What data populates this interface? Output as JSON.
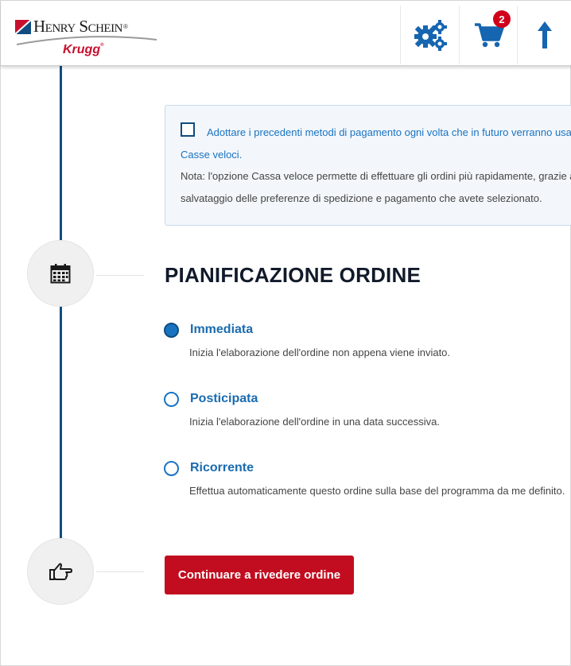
{
  "header": {
    "logo_brand": "Henry Schein",
    "logo_reg": "®",
    "logo_sub": "Krugg",
    "logo_sub_reg": "®",
    "cart_count": "2"
  },
  "info_box": {
    "checkbox_label": "Adottare i precedenti metodi di pagamento ogni volta che in futuro verranno usate le",
    "checkbox_label_cont": "Casse veloci.",
    "note_line1": "Nota: l'opzione Cassa veloce permette di effettuare gli ordini più rapidamente, grazie al",
    "note_line2": "salvataggio delle preferenze di spedizione e pagamento che avete selezionato."
  },
  "scheduling": {
    "title": "PIANIFICAZIONE ORDINE",
    "options": [
      {
        "label": "Immediata",
        "description": "Inizia l'elaborazione dell'ordine non appena viene inviato.",
        "checked": true
      },
      {
        "label": "Posticipata",
        "description": "Inizia l'elaborazione dell'ordine in una data successiva.",
        "checked": false
      },
      {
        "label": "Ricorrente",
        "description": "Effettua automaticamente questo ordine sulla base del programma da me definito.",
        "checked": false
      }
    ]
  },
  "continue_label": "Continuare a rivedere ordine",
  "colors": {
    "primary_blue": "#0f4c81",
    "link_blue": "#1a73c1",
    "button_red": "#c10d1f",
    "badge_red": "#d0021b"
  },
  "icons": [
    "settings-gears-icon",
    "shopping-cart-icon",
    "arrow-up-icon",
    "calendar-icon",
    "hand-pointing-icon"
  ]
}
